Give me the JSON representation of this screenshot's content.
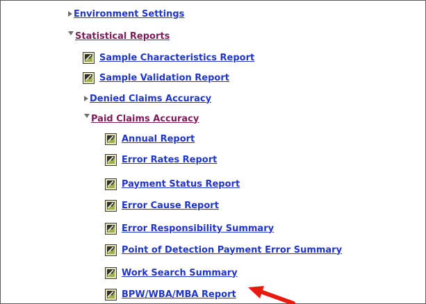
{
  "tree": {
    "environment_settings": "Environment Settings",
    "statistical_reports": "Statistical Reports",
    "sample_characteristics": "Sample Characteristics Report",
    "sample_validation": "Sample Validation Report",
    "denied_claims_accuracy": "Denied Claims Accuracy",
    "paid_claims_accuracy": "Paid Claims Accuracy",
    "paid_claims_items": [
      "Annual Report",
      "Error Rates Report",
      "Payment Status Report",
      "Error Cause Report",
      "Error Responsibility Summary",
      "Point of Detection Payment Error Summary",
      "Work Search Summary",
      "BPW/WBA/MBA Report"
    ]
  },
  "colors": {
    "link_unvisited": "#1f35c9",
    "link_visited": "#7d1b59",
    "expander": "#6f6f6f",
    "annotation_arrow": "#e8190f"
  },
  "icons": {
    "collapsed": "triangle-right-icon",
    "expanded": "triangle-down-icon",
    "report": "report-document-icon"
  }
}
